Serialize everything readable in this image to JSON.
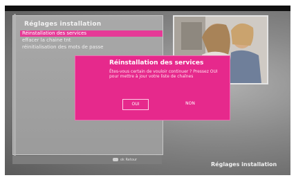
{
  "menu": {
    "title": "Réglages installation",
    "items": [
      {
        "label": "Réinstallation des services",
        "selected": true
      },
      {
        "label": "effacer la chaine tnt"
      },
      {
        "label": "réinitialisation des mots de passe"
      }
    ]
  },
  "dialog": {
    "title": "Réinstallation des services",
    "message": "Êtes-vous certain de vouloir continuer ? Pressez OUI pour mettre à jour votre liste de chaînes",
    "yes_label": "OUI",
    "no_label": "NON"
  },
  "bottom": {
    "ok_hint": "ok Retour",
    "section_label": "Réglages installation"
  },
  "colors": {
    "accent": "#e6298c",
    "panel": "#a3a3a3",
    "background": "#8a8a8a"
  }
}
